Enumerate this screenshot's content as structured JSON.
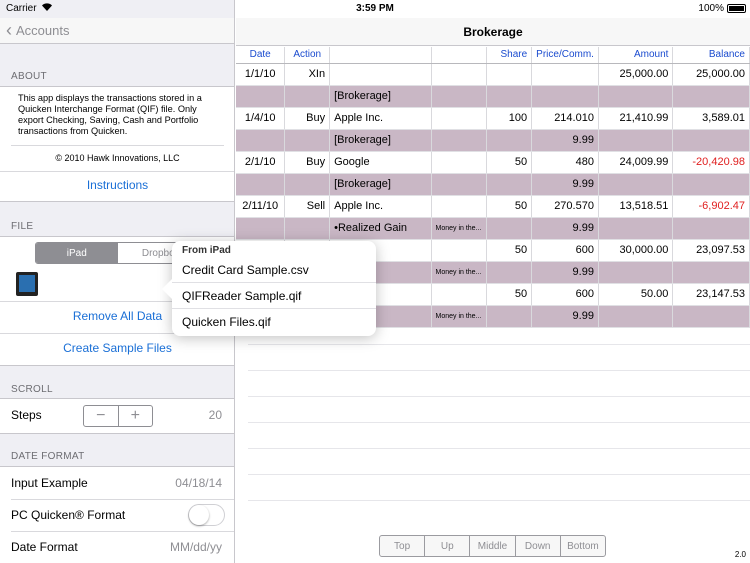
{
  "status": {
    "carrier": "Carrier",
    "time": "3:59 PM",
    "battery": "100%"
  },
  "left": {
    "back_label": "Accounts",
    "about": {
      "header": "ABOUT",
      "text": "This app displays the transactions stored in a Quicken Interchange Format (QIF) file. Only export Checking, Saving, Cash and Portfolio transactions from Quicken.",
      "copyright": "© 2010 Hawk Innovations, LLC",
      "instructions": "Instructions"
    },
    "file": {
      "header": "FILE",
      "segments": [
        "iPad",
        "Dropbo"
      ],
      "remove_all": "Remove All Data",
      "create_sample": "Create Sample Files"
    },
    "scroll": {
      "header": "SCROLL",
      "steps_label": "Steps",
      "minus": "−",
      "plus": "+",
      "steps_value": "20"
    },
    "date_format": {
      "header": "DATE FORMAT",
      "input_example_label": "Input Example",
      "input_example_value": "04/18/14",
      "pc_quicken_label": "PC Quicken® Format",
      "pc_quicken_on": false,
      "date_format_label": "Date Format",
      "date_format_value": "MM/dd/yy"
    }
  },
  "right": {
    "title": "Brokerage",
    "columns": [
      "Date",
      "Action",
      "",
      "",
      "Share",
      "Price/Comm.",
      "Amount",
      "Balance"
    ],
    "rows": [
      {
        "type": "tx",
        "date": "1/1/10",
        "action": "XIn",
        "desc": "",
        "memo": "",
        "share": "",
        "price": "",
        "amount": "25,000.00",
        "balance": "25,000.00",
        "neg": false
      },
      {
        "type": "split",
        "desc": "[Brokerage]",
        "memo": "",
        "price": ""
      },
      {
        "type": "tx",
        "date": "1/4/10",
        "action": "Buy",
        "desc": "Apple Inc.",
        "memo": "",
        "share": "100",
        "price": "214.010",
        "amount": "21,410.99",
        "balance": "3,589.01",
        "neg": false
      },
      {
        "type": "split",
        "desc": "[Brokerage]",
        "memo": "",
        "price": "9.99"
      },
      {
        "type": "tx",
        "date": "2/1/10",
        "action": "Buy",
        "desc": "Google",
        "memo": "",
        "share": "50",
        "price": "480",
        "amount": "24,009.99",
        "balance": "-20,420.98",
        "neg": true
      },
      {
        "type": "split",
        "desc": "[Brokerage]",
        "memo": "",
        "price": "9.99"
      },
      {
        "type": "tx",
        "date": "2/11/10",
        "action": "Sell",
        "desc": "Apple Inc.",
        "memo": "",
        "share": "50",
        "price": "270.570",
        "amount": "13,518.51",
        "balance": "-6,902.47",
        "neg": true
      },
      {
        "type": "split",
        "desc": "•Realized Gain",
        "memo": "Money in the...",
        "price": "9.99"
      },
      {
        "type": "tx",
        "date": "",
        "action": "",
        "desc": "",
        "memo": "",
        "share": "50",
        "price": "600",
        "amount": "30,000.00",
        "balance": "23,097.53",
        "neg": false
      },
      {
        "type": "split",
        "desc": "Gain",
        "memo": "Money in the...",
        "price": "9.99"
      },
      {
        "type": "tx",
        "date": "",
        "action": "",
        "desc": "c.",
        "memo": "",
        "share": "50",
        "price": "600",
        "amount": "50.00",
        "balance": "23,147.53",
        "neg": false
      },
      {
        "type": "split",
        "desc": "me",
        "memo": "Money in the...",
        "price": "9.99"
      }
    ],
    "bottom_buttons": [
      "Top",
      "Up",
      "Middle",
      "Down",
      "Bottom"
    ],
    "version": "2.0"
  },
  "popover": {
    "header": "From iPad",
    "items": [
      "Credit Card Sample.csv",
      "QIFReader Sample.qif",
      "Quicken Files.qif"
    ]
  },
  "colors": {
    "link": "#1a6fd6",
    "header_blue": "#1a4bcf",
    "split_row": "#c9b7c5",
    "negative": "#e02020"
  }
}
